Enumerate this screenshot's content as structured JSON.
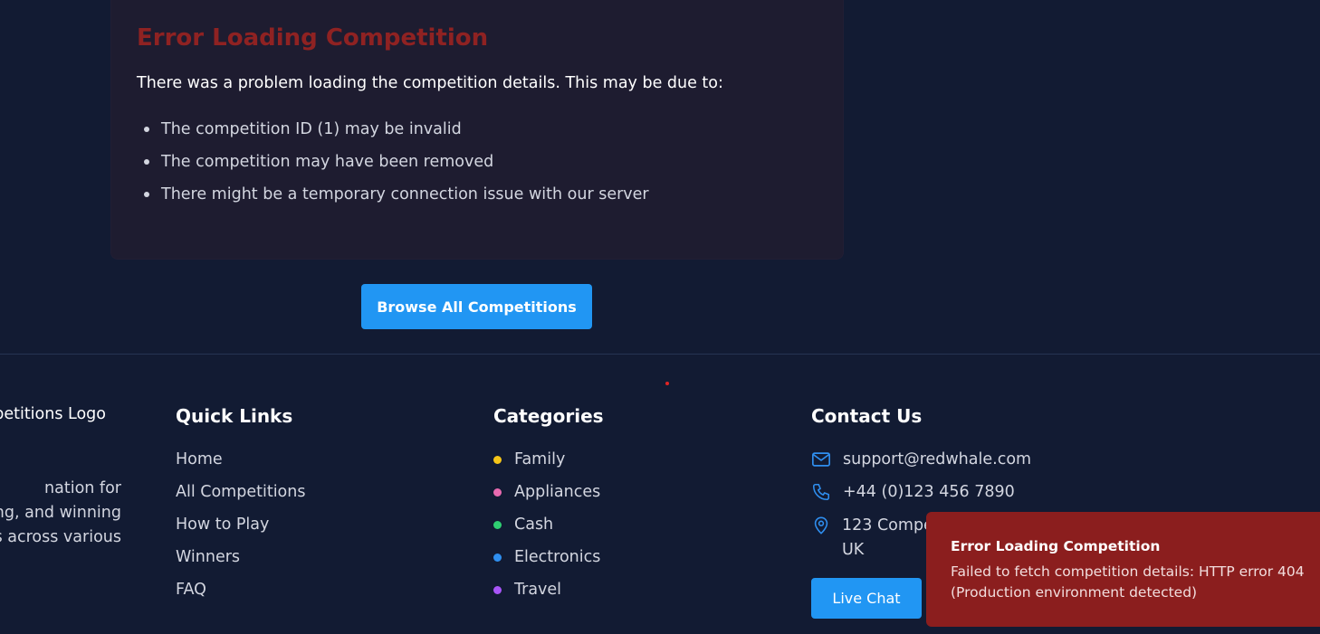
{
  "error_card": {
    "title": "Error Loading Competition",
    "description": "There was a problem loading the competition details. This may be due to:",
    "reasons": [
      "The competition ID (1) may be invalid",
      "The competition may have been removed",
      "There might be a temporary connection issue with our server"
    ]
  },
  "browse_button": {
    "label": "Browse All Competitions"
  },
  "footer": {
    "logo_alt": "Competitions Logo",
    "about_lines": [
      "nation for",
      "ng, and winning",
      "s across various"
    ],
    "quick_links": {
      "heading": "Quick Links",
      "items": [
        "Home",
        "All Competitions",
        "How to Play",
        "Winners",
        "FAQ"
      ]
    },
    "categories": {
      "heading": "Categories",
      "items": [
        {
          "label": "Family",
          "color": "#f5c518"
        },
        {
          "label": "Appliances",
          "color": "#e86ab0"
        },
        {
          "label": "Cash",
          "color": "#2fcf72"
        },
        {
          "label": "Electronics",
          "color": "#2f8ff0"
        },
        {
          "label": "Travel",
          "color": "#a855f7"
        }
      ]
    },
    "contact": {
      "heading": "Contact Us",
      "email": "support@redwhale.com",
      "phone": "+44 (0)123 456 7890",
      "address_line1": "123 Compe",
      "address_line2": "UK",
      "live_chat_label": "Live Chat"
    }
  },
  "toast": {
    "title": "Error Loading Competition",
    "message": "Failed to fetch competition details: HTTP error 404 (Production environment detected)"
  },
  "colors": {
    "background": "#121b33",
    "accent": "#2196f3",
    "error_title": "#8f2222",
    "toast_bg": "#8b1e1e"
  }
}
